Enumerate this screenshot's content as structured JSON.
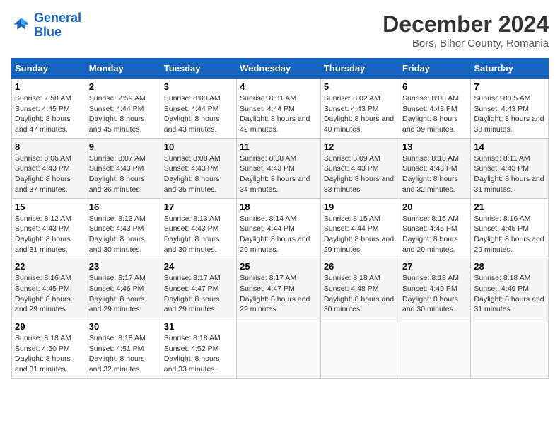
{
  "logo": {
    "line1": "General",
    "line2": "Blue"
  },
  "title": "December 2024",
  "subtitle": "Bors, Bihor County, Romania",
  "days_header": [
    "Sunday",
    "Monday",
    "Tuesday",
    "Wednesday",
    "Thursday",
    "Friday",
    "Saturday"
  ],
  "weeks": [
    [
      {
        "day": "1",
        "info": "Sunrise: 7:58 AM\nSunset: 4:45 PM\nDaylight: 8 hours and 47 minutes."
      },
      {
        "day": "2",
        "info": "Sunrise: 7:59 AM\nSunset: 4:44 PM\nDaylight: 8 hours and 45 minutes."
      },
      {
        "day": "3",
        "info": "Sunrise: 8:00 AM\nSunset: 4:44 PM\nDaylight: 8 hours and 43 minutes."
      },
      {
        "day": "4",
        "info": "Sunrise: 8:01 AM\nSunset: 4:44 PM\nDaylight: 8 hours and 42 minutes."
      },
      {
        "day": "5",
        "info": "Sunrise: 8:02 AM\nSunset: 4:43 PM\nDaylight: 8 hours and 40 minutes."
      },
      {
        "day": "6",
        "info": "Sunrise: 8:03 AM\nSunset: 4:43 PM\nDaylight: 8 hours and 39 minutes."
      },
      {
        "day": "7",
        "info": "Sunrise: 8:05 AM\nSunset: 4:43 PM\nDaylight: 8 hours and 38 minutes."
      }
    ],
    [
      {
        "day": "8",
        "info": "Sunrise: 8:06 AM\nSunset: 4:43 PM\nDaylight: 8 hours and 37 minutes."
      },
      {
        "day": "9",
        "info": "Sunrise: 8:07 AM\nSunset: 4:43 PM\nDaylight: 8 hours and 36 minutes."
      },
      {
        "day": "10",
        "info": "Sunrise: 8:08 AM\nSunset: 4:43 PM\nDaylight: 8 hours and 35 minutes."
      },
      {
        "day": "11",
        "info": "Sunrise: 8:08 AM\nSunset: 4:43 PM\nDaylight: 8 hours and 34 minutes."
      },
      {
        "day": "12",
        "info": "Sunrise: 8:09 AM\nSunset: 4:43 PM\nDaylight: 8 hours and 33 minutes."
      },
      {
        "day": "13",
        "info": "Sunrise: 8:10 AM\nSunset: 4:43 PM\nDaylight: 8 hours and 32 minutes."
      },
      {
        "day": "14",
        "info": "Sunrise: 8:11 AM\nSunset: 4:43 PM\nDaylight: 8 hours and 31 minutes."
      }
    ],
    [
      {
        "day": "15",
        "info": "Sunrise: 8:12 AM\nSunset: 4:43 PM\nDaylight: 8 hours and 31 minutes."
      },
      {
        "day": "16",
        "info": "Sunrise: 8:13 AM\nSunset: 4:43 PM\nDaylight: 8 hours and 30 minutes."
      },
      {
        "day": "17",
        "info": "Sunrise: 8:13 AM\nSunset: 4:43 PM\nDaylight: 8 hours and 30 minutes."
      },
      {
        "day": "18",
        "info": "Sunrise: 8:14 AM\nSunset: 4:44 PM\nDaylight: 8 hours and 29 minutes."
      },
      {
        "day": "19",
        "info": "Sunrise: 8:15 AM\nSunset: 4:44 PM\nDaylight: 8 hours and 29 minutes."
      },
      {
        "day": "20",
        "info": "Sunrise: 8:15 AM\nSunset: 4:45 PM\nDaylight: 8 hours and 29 minutes."
      },
      {
        "day": "21",
        "info": "Sunrise: 8:16 AM\nSunset: 4:45 PM\nDaylight: 8 hours and 29 minutes."
      }
    ],
    [
      {
        "day": "22",
        "info": "Sunrise: 8:16 AM\nSunset: 4:45 PM\nDaylight: 8 hours and 29 minutes."
      },
      {
        "day": "23",
        "info": "Sunrise: 8:17 AM\nSunset: 4:46 PM\nDaylight: 8 hours and 29 minutes."
      },
      {
        "day": "24",
        "info": "Sunrise: 8:17 AM\nSunset: 4:47 PM\nDaylight: 8 hours and 29 minutes."
      },
      {
        "day": "25",
        "info": "Sunrise: 8:17 AM\nSunset: 4:47 PM\nDaylight: 8 hours and 29 minutes."
      },
      {
        "day": "26",
        "info": "Sunrise: 8:18 AM\nSunset: 4:48 PM\nDaylight: 8 hours and 30 minutes."
      },
      {
        "day": "27",
        "info": "Sunrise: 8:18 AM\nSunset: 4:49 PM\nDaylight: 8 hours and 30 minutes."
      },
      {
        "day": "28",
        "info": "Sunrise: 8:18 AM\nSunset: 4:49 PM\nDaylight: 8 hours and 31 minutes."
      }
    ],
    [
      {
        "day": "29",
        "info": "Sunrise: 8:18 AM\nSunset: 4:50 PM\nDaylight: 8 hours and 31 minutes."
      },
      {
        "day": "30",
        "info": "Sunrise: 8:18 AM\nSunset: 4:51 PM\nDaylight: 8 hours and 32 minutes."
      },
      {
        "day": "31",
        "info": "Sunrise: 8:18 AM\nSunset: 4:52 PM\nDaylight: 8 hours and 33 minutes."
      },
      null,
      null,
      null,
      null
    ]
  ]
}
